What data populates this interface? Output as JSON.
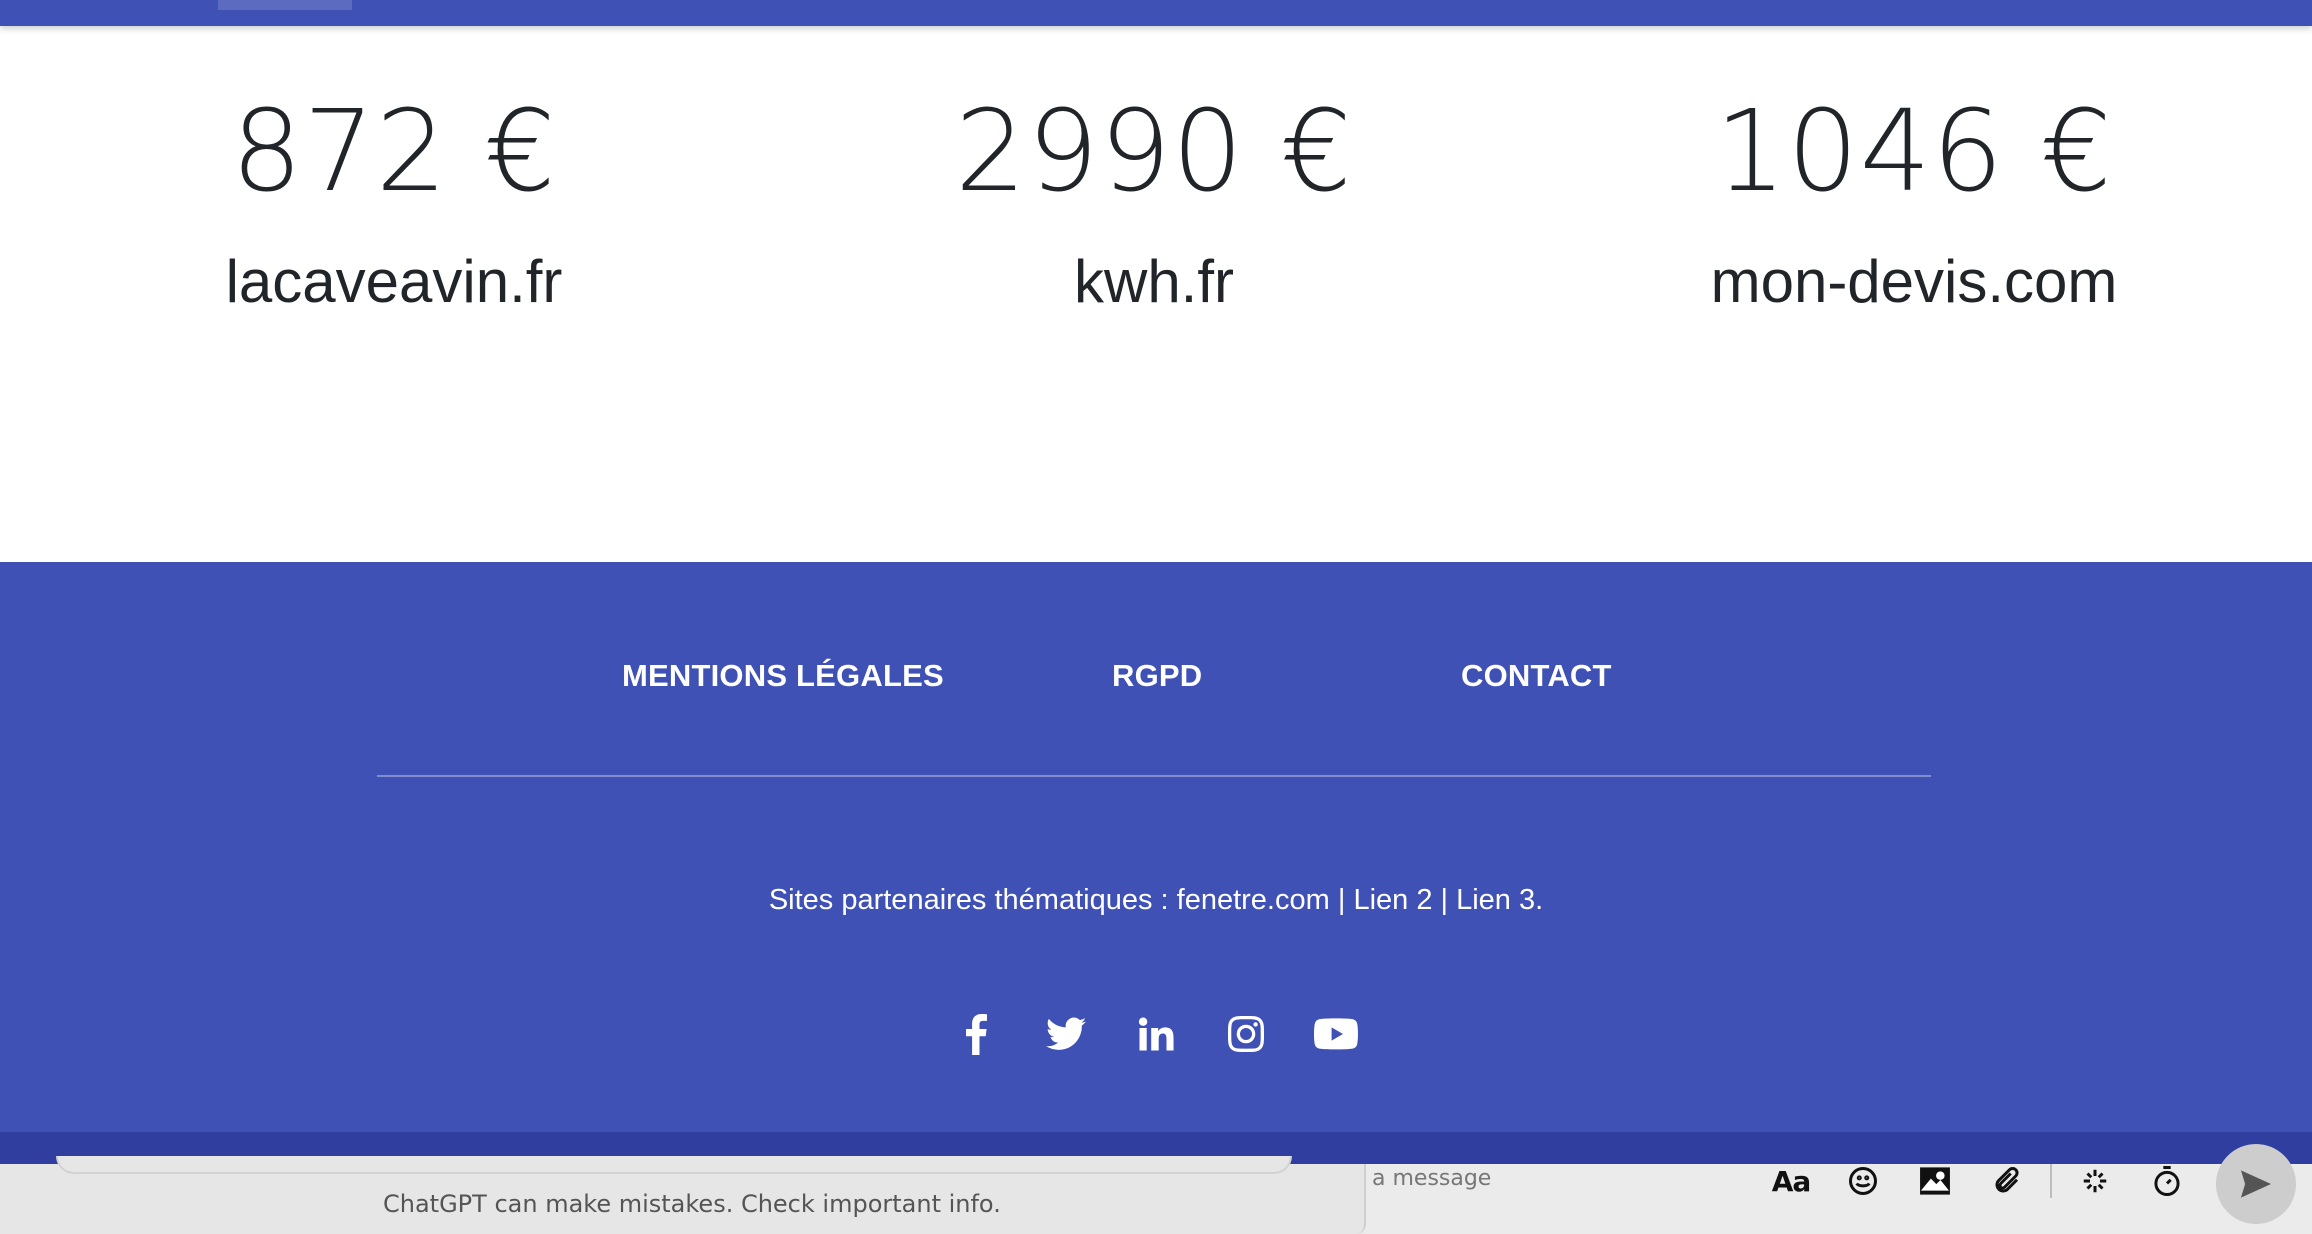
{
  "stats": [
    {
      "amount": "872 €",
      "site": "lacaveavin.fr"
    },
    {
      "amount": "2990 €",
      "site": "kwh.fr"
    },
    {
      "amount": "1046 €",
      "site": "mon-devis.com"
    }
  ],
  "footer": {
    "links": [
      "MENTIONS LÉGALES",
      "RGPD",
      "CONTACT"
    ],
    "partners_prefix": "Sites partenaires thématiques : ",
    "partner_links": [
      "fenetre.com",
      "Lien 2",
      "Lien 3."
    ],
    "separator": " | ",
    "socials": [
      "facebook-icon",
      "twitter-icon",
      "linkedin-icon",
      "instagram-icon",
      "youtube-icon"
    ]
  },
  "chat": {
    "disclaimer": "ChatGPT can make mistakes. Check important info.",
    "message_placeholder": "a message",
    "font_tool_label": "Aa"
  },
  "colors": {
    "primary": "#3f51b5",
    "primary_dark": "#303f9f",
    "text": "#212529"
  }
}
